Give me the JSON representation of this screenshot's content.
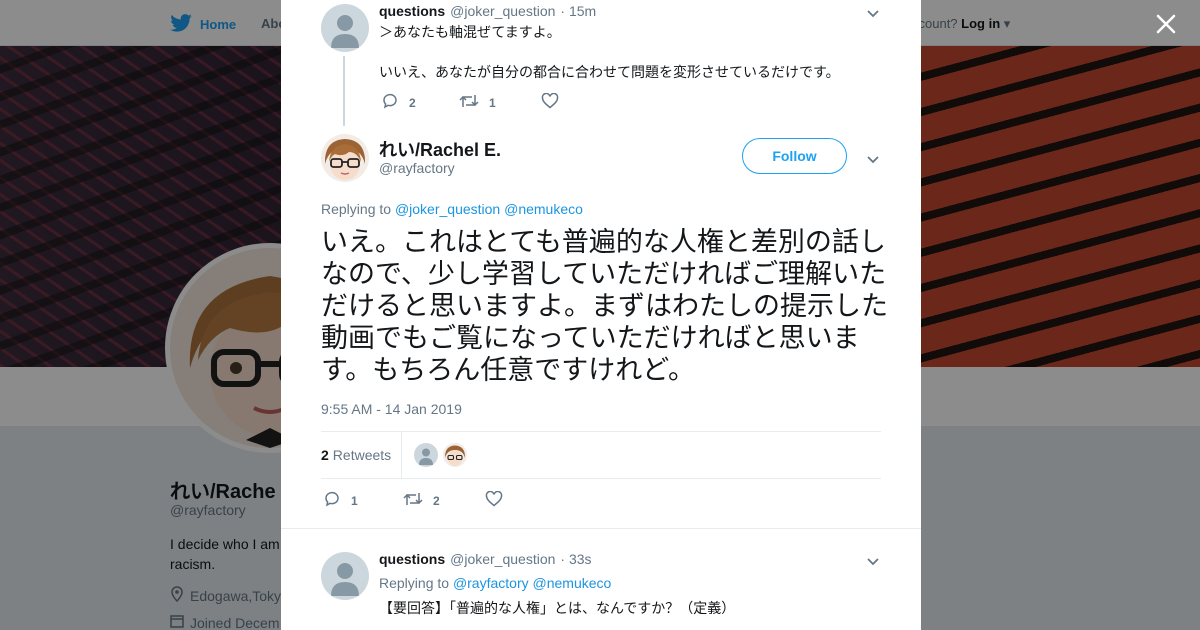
{
  "background": {
    "nav": {
      "home_label": "Home",
      "about_label": "Abo",
      "account_text": "ccount?",
      "login_label": "Log in"
    },
    "profile": {
      "name": "れい/Rache",
      "handle": "@rayfactory",
      "bio": "I decide who I am racism.",
      "location": "Edogawa,Toky",
      "joined": "Joined Decem"
    }
  },
  "modal": {
    "parent_tweet": {
      "name": "questions",
      "handle": "@joker_question",
      "time": "· 15m",
      "lines": [
        "＞あなたも軸混ぜてますよ。",
        "いいえ、あなたが自分の都合に合わせて問題を変形させているだけです。"
      ],
      "reply_count": "2",
      "retweet_count": "1",
      "like_count": ""
    },
    "main_tweet": {
      "name": "れい/Rachel E.",
      "handle": "@rayfactory",
      "follow_label": "Follow",
      "replying_prefix": "Replying to",
      "replying_to": [
        "@joker_question",
        "@nemukeco"
      ],
      "text": "いえ。これはとても普遍的な人権と差別の話しなので、少し学習していただければご理解いただけると思いますよ。まずはわたしの提示した動画でもご覧になっていただければと思います。もちろん任意ですけれど。",
      "timestamp": "9:55 AM - 14 Jan 2019",
      "retweets_count": "2",
      "retweets_label": "Retweets",
      "reply_count": "1",
      "retweet_count": "2",
      "like_count": ""
    },
    "reply_tweet": {
      "name": "questions",
      "handle": "@joker_question",
      "time": "· 33s",
      "replying_prefix": "Replying to",
      "replying_to": [
        "@rayfactory",
        "@nemukeco"
      ],
      "text": "【要回答】「普遍的な人権」とは、なんですか？（定義）"
    }
  },
  "colors": {
    "accent": "#1da1f2",
    "link": "#1b95e0",
    "muted": "#657786",
    "text": "#14171a",
    "border": "#e6ecf0"
  }
}
